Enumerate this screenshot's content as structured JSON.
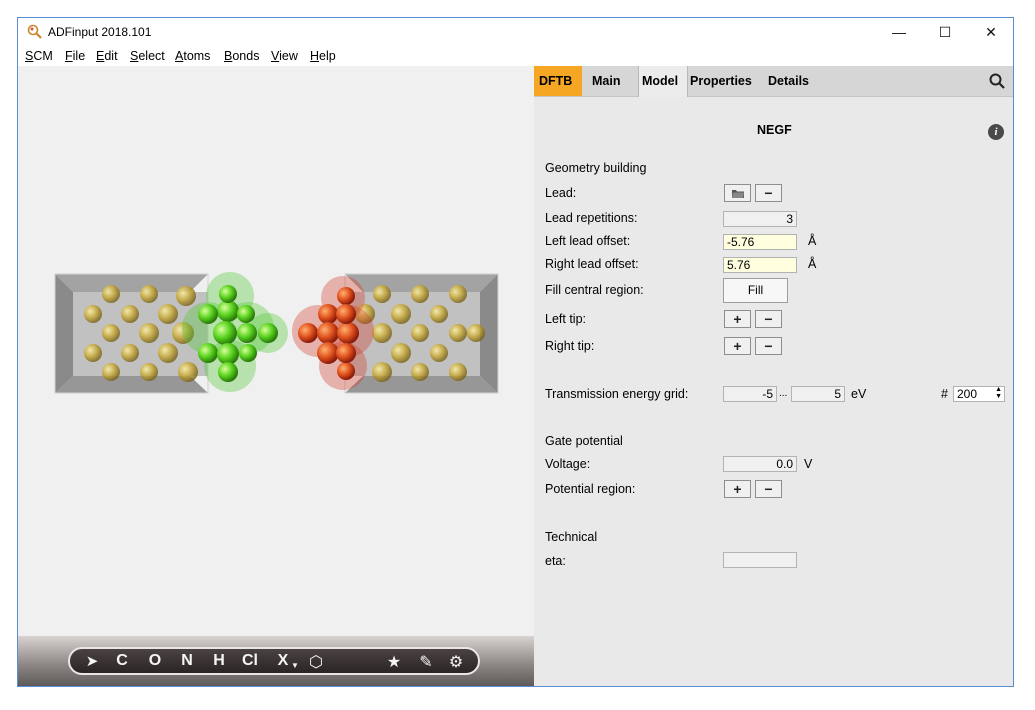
{
  "window": {
    "title": "ADFinput 2018.101",
    "minimize": "—",
    "maximize": "☐",
    "close": "✕"
  },
  "menu": [
    "SCM",
    "File",
    "Edit",
    "Select",
    "Atoms",
    "Bonds",
    "View",
    "Help"
  ],
  "tabs": {
    "dftb": "DFTB",
    "main": "Main",
    "model": "Model",
    "properties": "Properties",
    "details": "Details"
  },
  "panel": {
    "title": "NEGF",
    "info": "i",
    "geometry_section": "Geometry building",
    "lead_label": "Lead:",
    "lead_repetitions_label": "Lead repetitions:",
    "lead_repetitions_value": "3",
    "left_lead_offset_label": "Left lead offset:",
    "left_lead_offset_value": "-5.76",
    "right_lead_offset_label": "Right lead offset:",
    "right_lead_offset_value": "5.76",
    "offset_unit": "Å",
    "fill_central_label": "Fill central region:",
    "fill_button": "Fill",
    "left_tip_label": "Left tip:",
    "right_tip_label": "Right tip:",
    "transmission_label": "Transmission energy grid:",
    "transmission_min": "-5",
    "transmission_sep": "...",
    "transmission_max": "5",
    "transmission_unit": "eV",
    "points_symbol": "#",
    "points_value": "200",
    "gate_section": "Gate potential",
    "voltage_label": "Voltage:",
    "voltage_value": "0.0",
    "voltage_unit": "V",
    "potential_region_label": "Potential region:",
    "technical_section": "Technical",
    "eta_label": "eta:",
    "eta_value": ""
  },
  "buttons": {
    "plus": "+",
    "minus": "−"
  },
  "toolbar": [
    "C",
    "O",
    "N",
    "H",
    "Cl",
    "X",
    "★"
  ],
  "colors": {
    "accent": "#f5a623",
    "green_atoms": "#3cc81e",
    "red_atoms": "#d2281e",
    "gold_atoms": "#c8a832"
  }
}
